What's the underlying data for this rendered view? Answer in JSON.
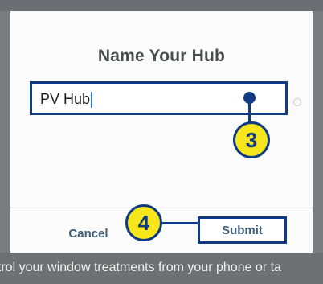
{
  "dialog": {
    "title": "Name Your Hub",
    "hub_name_value": "PV Hub",
    "cancel_label": "Cancel",
    "submit_label": "Submit"
  },
  "callouts": {
    "step_3": "3",
    "step_4": "4"
  },
  "background": {
    "caption": "ntrol your window treatments from your phone or ta"
  },
  "colors": {
    "highlight_border": "#103a82",
    "badge_fill": "#f7e61a",
    "button_text": "#3f5f7a",
    "title_text": "#4a4d50"
  },
  "icons": {
    "clear": "clear-field-icon"
  }
}
